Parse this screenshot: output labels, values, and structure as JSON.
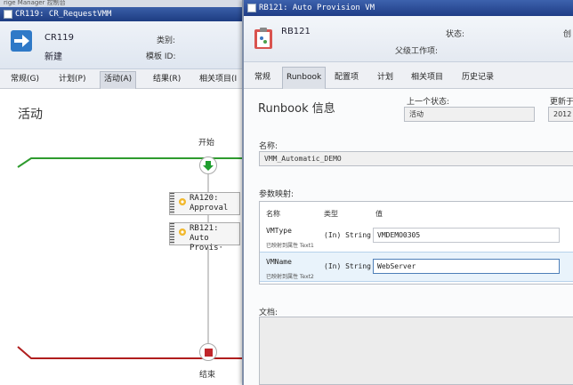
{
  "back_window": {
    "strip_text": "rige Manager 控制台",
    "title": "CR119: CR_RequestVMM",
    "header": {
      "id": "CR119",
      "status": "新建",
      "category_label": "类别:",
      "template_label": "模板 ID:"
    },
    "tabs": [
      "常规(G)",
      "计划(P)",
      "活动(A)",
      "结果(R)",
      "相关项目(I"
    ],
    "active_tab": 2,
    "section_title": "活动",
    "flow": {
      "start_label": "开始",
      "end_label": "结束",
      "nodes": [
        {
          "id": "RA120:",
          "name": "Approval"
        },
        {
          "id": "RB121:",
          "name": "Auto Provis·"
        }
      ]
    }
  },
  "front_window": {
    "title": "RB121: Auto Provision VM",
    "header": {
      "id": "RB121",
      "status_label": "状态:",
      "parent_label": "父级工作项:",
      "right_cut": "创"
    },
    "tabs": [
      "常规",
      "Runbook",
      "配置项",
      "计划",
      "相关项目",
      "历史记录"
    ],
    "active_tab": 1,
    "section_title": "Runbook 信息",
    "prev_status_label": "上一个状态:",
    "prev_status_value": "活动",
    "updated_label": "更新于",
    "updated_value": "2012",
    "name_label": "名称:",
    "name_value": "VMM_Automatic_DEMO",
    "param_map_label": "参数映射:",
    "table": {
      "headers": [
        "名称",
        "类型",
        "值"
      ],
      "rows": [
        {
          "name": "VMType",
          "sub": "已映射到属性 Text1",
          "type": "(In) String",
          "value": "VMDEMO0305"
        },
        {
          "name": "VMName",
          "sub": "已映射到属性 Text2",
          "type": "(In) String",
          "value": "WebServer"
        }
      ]
    },
    "doc_label": "文档:"
  },
  "colors": {
    "titlebar": "#1f3d86",
    "flow_green": "#2e9b2e",
    "flow_red": "#b01e1e",
    "start_node": "#1f9e2f",
    "end_node": "#c0262b"
  }
}
